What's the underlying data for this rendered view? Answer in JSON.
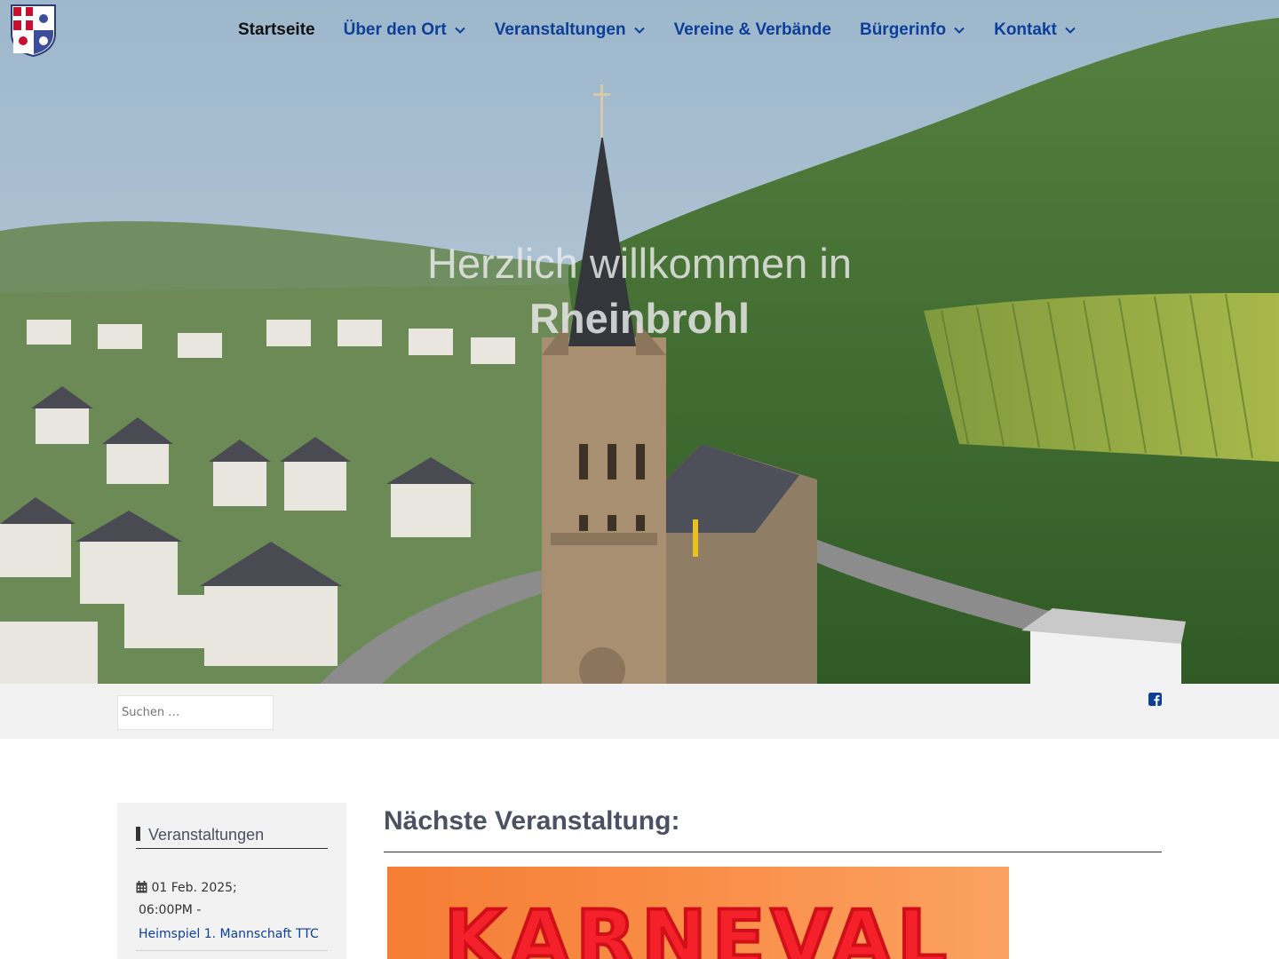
{
  "nav": {
    "items": [
      {
        "label": "Startseite",
        "active": true,
        "dropdown": false
      },
      {
        "label": "Über den Ort",
        "active": false,
        "dropdown": true
      },
      {
        "label": "Veranstaltungen",
        "active": false,
        "dropdown": true
      },
      {
        "label": "Vereine & Verbände",
        "active": false,
        "dropdown": false
      },
      {
        "label": "Bürgerinfo",
        "active": false,
        "dropdown": true
      },
      {
        "label": "Kontakt",
        "active": false,
        "dropdown": true
      }
    ]
  },
  "hero": {
    "line1": "Herzlich willkommen in",
    "line2": "Rheinbrohl"
  },
  "search": {
    "placeholder": "Suchen …"
  },
  "social": {
    "icon": "facebook-icon"
  },
  "sidebar": {
    "title": "Veranstaltungen",
    "events": [
      {
        "date": "01 Feb. 2025",
        "sep": ";",
        "time": "06:00PM",
        "dash": "-",
        "title": "Heimspiel 1. Mannschaft TTC"
      }
    ]
  },
  "main": {
    "title": "Nächste Veranstaltung:",
    "poster_text": "KARNEVAL"
  },
  "colors": {
    "nav_link": "#0d3f98",
    "nav_active": "#111111",
    "heading": "#4b5063",
    "bar_bg": "#f2f2f2",
    "poster_orange": "#f98e48",
    "poster_red": "#f4202a"
  }
}
